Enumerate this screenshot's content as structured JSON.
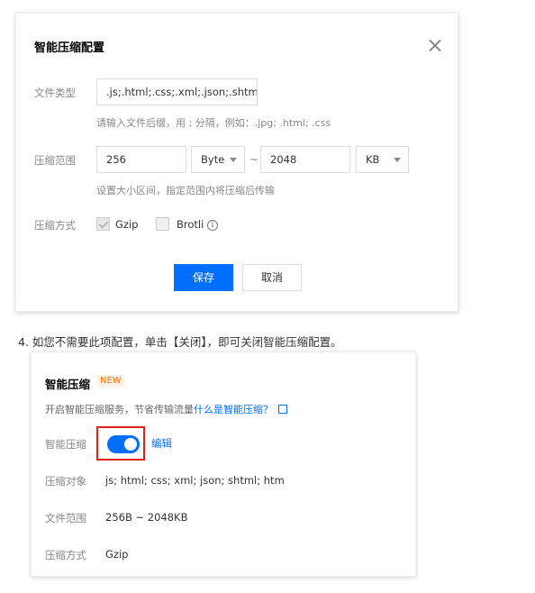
{
  "dialog": {
    "title": "智能压缩配置",
    "file_type_label": "文件类型",
    "file_type_value": ".js;.html;.css;.xml;.json;.shtml;",
    "file_type_hint": "请输入文件后缀，用 ; 分隔，例如：.jpg; .html; .css",
    "range_label": "压缩范围",
    "range_min": "256",
    "range_min_unit": "Byte",
    "range_sep": "~",
    "range_max": "2048",
    "range_max_unit": "KB",
    "range_hint": "设置大小区间，指定范围内将压缩后传输",
    "method_label": "压缩方式",
    "gzip_label": "Gzip",
    "gzip_checked": true,
    "brotli_label": "Brotli",
    "brotli_checked": false,
    "save_label": "保存",
    "cancel_label": "取消"
  },
  "step_text": "4. 如您不需要此项配置，单击【关闭】，即可关闭智能压缩配置。",
  "card": {
    "title": "智能压缩",
    "badge": "NEW",
    "desc_prefix": "开启智能压缩服务，节省传输流量",
    "desc_link": "什么是智能压缩？",
    "toggle_label": "智能压缩",
    "toggle_on": true,
    "edit_label": "编辑",
    "target_label": "压缩对象",
    "target_value": "js; html; css; xml; json; shtml; htm",
    "range_label": "文件范围",
    "range_value": "256B ~ 2048KB",
    "method_label": "压缩方式",
    "method_value": "Gzip"
  },
  "colors": {
    "primary": "#006eff",
    "highlight": "#e02020",
    "badge": "#ff7200"
  }
}
